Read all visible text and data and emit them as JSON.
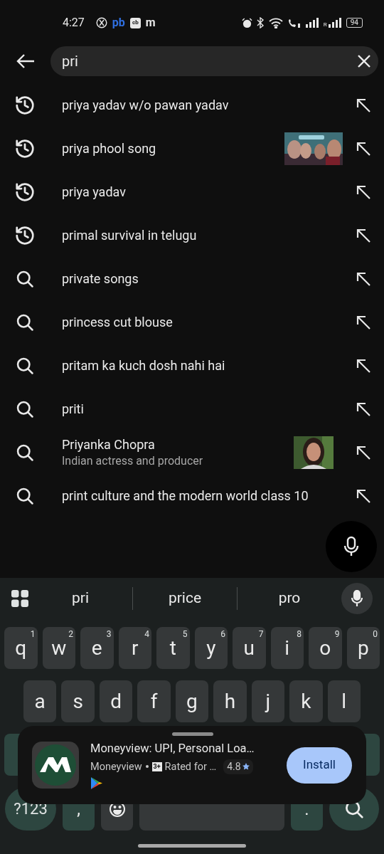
{
  "status_bar": {
    "time": "4:27",
    "notifications": [
      {
        "kind": "icon"
      },
      {
        "kind": "text",
        "text": "pb",
        "color": "#2f6fe0"
      },
      {
        "kind": "boxed",
        "text": "cb"
      },
      {
        "kind": "text",
        "text": "m",
        "color": "#e8e8e8"
      }
    ],
    "roaming": "R",
    "battery": "94"
  },
  "search": {
    "value": "pri"
  },
  "suggestions": [
    {
      "kind": "history",
      "text": "priya yadav w/o pawan yadav"
    },
    {
      "kind": "history",
      "text": "priya phool song",
      "picture": true
    },
    {
      "kind": "history",
      "text": "priya yadav"
    },
    {
      "kind": "history",
      "text": "primal survival in telugu"
    },
    {
      "kind": "search",
      "text": "private songs"
    },
    {
      "kind": "search",
      "text": "princess cut blouse"
    },
    {
      "kind": "search",
      "text": "pritam ka kuch dosh nahi hai"
    },
    {
      "kind": "search",
      "text": "priti"
    },
    {
      "kind": "search",
      "text": "Priyanka Chopra",
      "subtitle": "Indian actress and producer",
      "picture": true
    },
    {
      "kind": "search",
      "text": "print culture and the modern world class 10"
    }
  ],
  "keyboard": {
    "word_suggestions": [
      "pri",
      "price",
      "pro"
    ],
    "row_1": [
      {
        "label": "q",
        "hint": "1"
      },
      {
        "label": "w",
        "hint": "2"
      },
      {
        "label": "e",
        "hint": "3"
      },
      {
        "label": "r",
        "hint": "4"
      },
      {
        "label": "t",
        "hint": "5"
      },
      {
        "label": "y",
        "hint": "6"
      },
      {
        "label": "u",
        "hint": "7"
      },
      {
        "label": "i",
        "hint": "8"
      },
      {
        "label": "o",
        "hint": "9"
      },
      {
        "label": "p",
        "hint": "0"
      }
    ],
    "row_2": [
      "a",
      "s",
      "d",
      "f",
      "g",
      "h",
      "j",
      "k",
      "l"
    ],
    "bottom_row": [
      {
        "kind": "symbols",
        "label": "?123"
      },
      {
        "kind": "char",
        "label": ","
      },
      {
        "kind": "emoji"
      },
      {
        "kind": "space"
      },
      {
        "kind": "char",
        "label": "."
      },
      {
        "kind": "search"
      }
    ]
  },
  "app_ad": {
    "title": "Moneyview: UPI, Personal Loa…",
    "developer": "Moneyview",
    "age_badge": "3+",
    "rating_label": "Rated for …",
    "rating": "4.8",
    "button": "Install"
  }
}
